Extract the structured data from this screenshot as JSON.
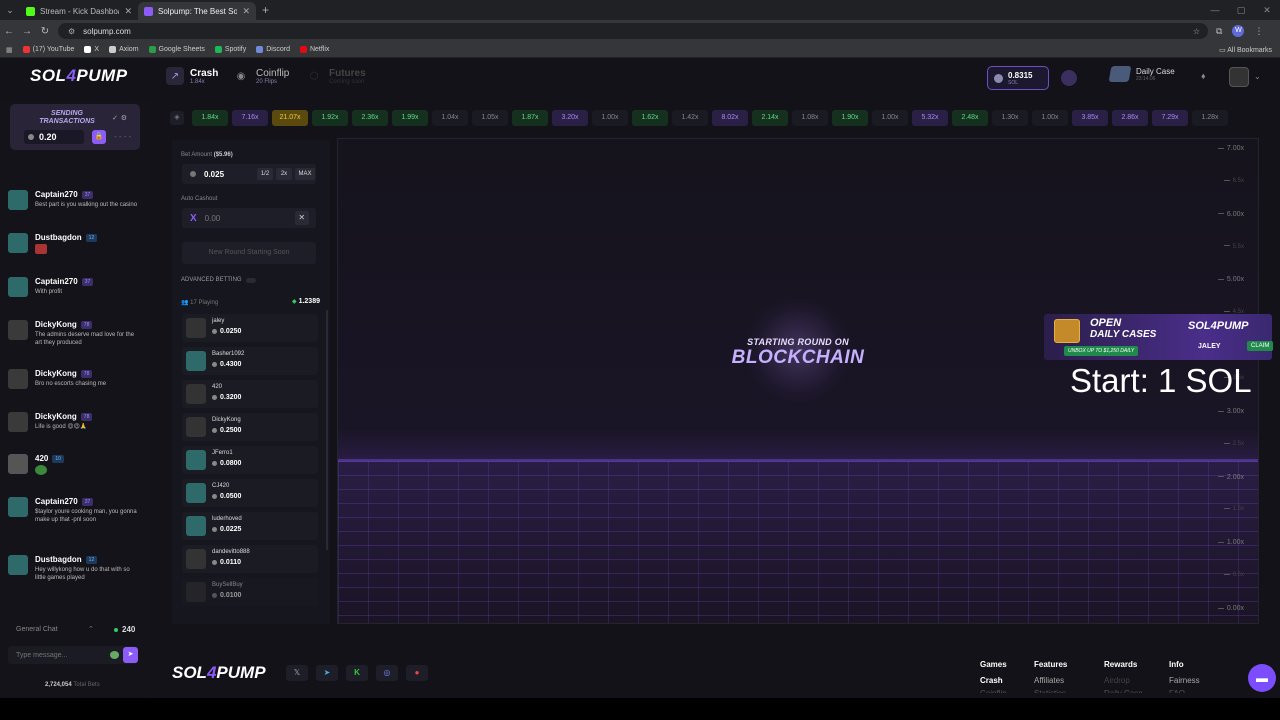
{
  "browser": {
    "tabs": [
      {
        "title": "Stream - Kick Dashboard",
        "color": "#53fc18",
        "active": false
      },
      {
        "title": "Solpump: The Best Solana Cr",
        "color": "#8b5cf6",
        "active": true
      }
    ],
    "url": "solpump.com",
    "bookmarks": [
      {
        "label": "(17) YouTube",
        "color": "#e33"
      },
      {
        "label": "X",
        "color": "#fff"
      },
      {
        "label": "Axiom",
        "color": "#ccc"
      },
      {
        "label": "Google Sheets",
        "color": "#2a9d4a"
      },
      {
        "label": "Spotify",
        "color": "#1db954"
      },
      {
        "label": "Discord",
        "color": "#7289da"
      },
      {
        "label": "Netflix",
        "color": "#e50914"
      }
    ],
    "all_bookmarks": "All Bookmarks",
    "profile_initial": "W"
  },
  "nav": {
    "logo_left": "SOL",
    "logo_mid": "4",
    "logo_right": "PUMP",
    "games": [
      {
        "name": "Crash",
        "sub": "1.84x"
      },
      {
        "name": "Coinflip",
        "sub": "20 Flips"
      },
      {
        "name": "Futures",
        "sub": "Coming soon"
      }
    ],
    "balance": {
      "value": "0.8315",
      "unit": "SOL"
    },
    "daily": {
      "name": "Daily Case",
      "time": "23:14:06"
    }
  },
  "sidebar": {
    "sending_title": "SENDING TRANSACTIONS",
    "sending_amount": "0.20",
    "dashes": "- - - -",
    "messages": [
      {
        "user": "Captain270",
        "level": "37",
        "text": "Best part is you walking out the casino",
        "av": "teal",
        "lvlc": "purple"
      },
      {
        "user": "Dustbagdon",
        "level": "12",
        "text": "",
        "av": "teal",
        "lvlc": "blue",
        "img": "red"
      },
      {
        "user": "Captain270",
        "level": "37",
        "text": "With profit",
        "av": "teal",
        "lvlc": "purple"
      },
      {
        "user": "DickyKong",
        "level": "78",
        "text": "The admins deserve mad love for the art they produced",
        "av": "dark",
        "lvlc": "purple"
      },
      {
        "user": "DickyKong",
        "level": "78",
        "text": "Bro no escorts chasing me",
        "av": "dark",
        "lvlc": "purple"
      },
      {
        "user": "DickyKong",
        "level": "78",
        "text": "Life is good 😍😍🙏",
        "av": "dark",
        "lvlc": "purple"
      },
      {
        "user": "420",
        "level": "10",
        "text": "",
        "av": "gray",
        "lvlc": "blue",
        "img": "green"
      },
      {
        "user": "Captain270",
        "level": "37",
        "text": "$taylor youre cooking man, you gonna make up that -pnl soon",
        "av": "teal",
        "lvlc": "purple"
      },
      {
        "user": "Dustbagdon",
        "level": "12",
        "text": "Hey willykong how u do that with so little games played",
        "av": "teal",
        "lvlc": "blue"
      }
    ],
    "general_chat": "General Chat",
    "online": "240",
    "chat_placeholder": "Type message...",
    "total_bets_value": "2,724,054",
    "total_bets_label": "Total Bets"
  },
  "history": [
    {
      "v": "1.84x",
      "c": "g"
    },
    {
      "v": "7.16x",
      "c": "p"
    },
    {
      "v": "21.07x",
      "c": "y"
    },
    {
      "v": "1.92x",
      "c": "g"
    },
    {
      "v": "2.36x",
      "c": "g"
    },
    {
      "v": "1.99x",
      "c": "g"
    },
    {
      "v": "1.04x",
      "c": "n"
    },
    {
      "v": "1.05x",
      "c": "n"
    },
    {
      "v": "1.87x",
      "c": "g"
    },
    {
      "v": "3.20x",
      "c": "p"
    },
    {
      "v": "1.00x",
      "c": "n"
    },
    {
      "v": "1.62x",
      "c": "g"
    },
    {
      "v": "1.42x",
      "c": "n"
    },
    {
      "v": "8.02x",
      "c": "p"
    },
    {
      "v": "2.14x",
      "c": "g"
    },
    {
      "v": "1.08x",
      "c": "n"
    },
    {
      "v": "1.90x",
      "c": "g"
    },
    {
      "v": "1.00x",
      "c": "n"
    },
    {
      "v": "5.32x",
      "c": "p"
    },
    {
      "v": "2.48x",
      "c": "g"
    },
    {
      "v": "1.30x",
      "c": "n"
    },
    {
      "v": "1.00x",
      "c": "n"
    },
    {
      "v": "3.85x",
      "c": "p"
    },
    {
      "v": "2.86x",
      "c": "p"
    },
    {
      "v": "7.29x",
      "c": "p"
    },
    {
      "v": "1.28x",
      "c": "n"
    }
  ],
  "bet": {
    "amount_label": "Bet Amount",
    "amount_usd": "($5.96)",
    "amount": "0.025",
    "half": "1/2",
    "double": "2x",
    "max": "MAX",
    "auto_label": "Auto Cashout",
    "auto_value": "0.00",
    "round_button": "New Round Starting Soon",
    "advanced": "ADVANCED BETTING",
    "playing": "17 Playing",
    "pot": "1.2389",
    "players": [
      {
        "name": "jaley",
        "amt": "0.0250",
        "av": "dark"
      },
      {
        "name": "Basher1092",
        "amt": "0.4300",
        "av": "teal"
      },
      {
        "name": "420",
        "amt": "0.3200",
        "av": "dark"
      },
      {
        "name": "DickyKong",
        "amt": "0.2500",
        "av": "dark"
      },
      {
        "name": "JFerro1",
        "amt": "0.0800",
        "av": "teal"
      },
      {
        "name": "CJ420",
        "amt": "0.0500",
        "av": "teal"
      },
      {
        "name": "luderhoved",
        "amt": "0.0225",
        "av": "teal"
      },
      {
        "name": "dandevitto888",
        "amt": "0.0110",
        "av": "dark"
      },
      {
        "name": "BuySellBuy",
        "amt": "0.0100",
        "av": "dark"
      }
    ]
  },
  "game": {
    "starting": "STARTING ROUND ON",
    "blockchain": "BLOCKCHAIN",
    "yticks": [
      {
        "label": "7.00x",
        "minor": false
      },
      {
        "label": "6.5x",
        "minor": true
      },
      {
        "label": "6.00x",
        "minor": false
      },
      {
        "label": "5.5x",
        "minor": true
      },
      {
        "label": "5.00x",
        "minor": false
      },
      {
        "label": "4.5x",
        "minor": true
      },
      {
        "label": "4.00x",
        "minor": false
      },
      {
        "label": "3.5x",
        "minor": true
      },
      {
        "label": "3.00x",
        "minor": false
      },
      {
        "label": "2.5x",
        "minor": true
      },
      {
        "label": "2.00x",
        "minor": false
      },
      {
        "label": "1.5x",
        "minor": true
      },
      {
        "label": "1.00x",
        "minor": false
      },
      {
        "label": "0.5x",
        "minor": true
      },
      {
        "label": "0.00x",
        "minor": false
      }
    ]
  },
  "overlay": {
    "open": "OPEN",
    "daily_cases": "DAILY CASES",
    "unbox": "UNBOX UP TO $1,250 DAILY",
    "logo": "SOL4PUMP",
    "user": "JALEY",
    "claim": "CLAIM",
    "start_text": "Start: 1 SOL"
  },
  "footer": {
    "columns": [
      {
        "head": "Games",
        "links": [
          "Crash",
          "Coinflip"
        ]
      },
      {
        "head": "Features",
        "links": [
          "Affiliates",
          "Statistics"
        ]
      },
      {
        "head": "Rewards",
        "links": [
          "Airdrop",
          "Daily Case"
        ]
      },
      {
        "head": "Info",
        "links": [
          "Fairness",
          "FAQ"
        ]
      }
    ]
  }
}
